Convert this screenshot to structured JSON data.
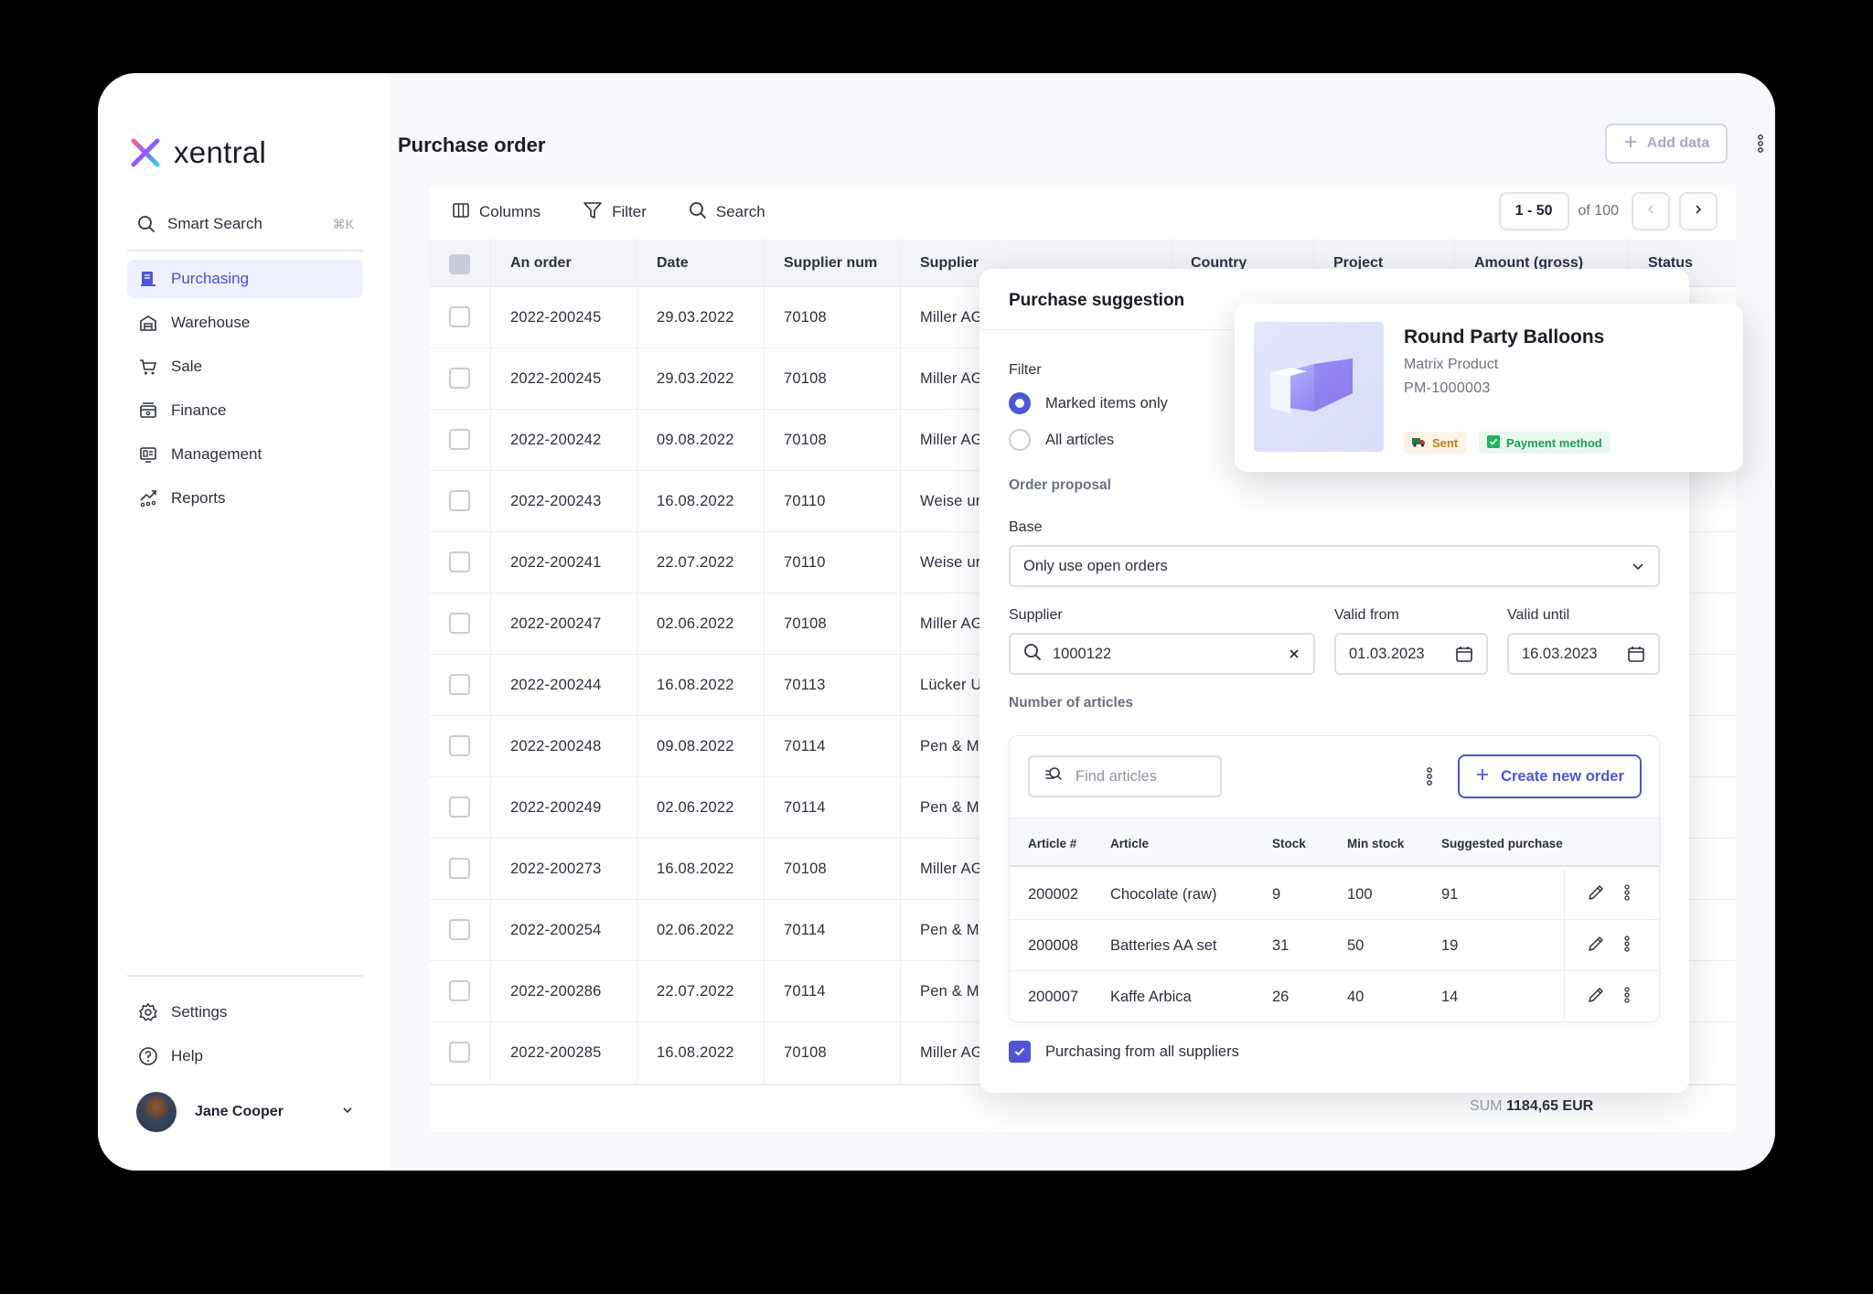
{
  "app": {
    "brand": "xentral",
    "accent": "#5054d6"
  },
  "sidebar": {
    "search_label": "Smart Search",
    "search_shortcut": "⌘K",
    "items": [
      {
        "label": "Purchasing",
        "icon": "purchasing-icon",
        "active": true
      },
      {
        "label": "Warehouse",
        "icon": "warehouse-icon"
      },
      {
        "label": "Sale",
        "icon": "cart-icon"
      },
      {
        "label": "Finance",
        "icon": "finance-icon"
      },
      {
        "label": "Management",
        "icon": "management-icon"
      },
      {
        "label": "Reports",
        "icon": "reports-icon"
      }
    ],
    "bottom_items": [
      {
        "label": "Settings",
        "icon": "gear-icon"
      },
      {
        "label": "Help",
        "icon": "help-icon"
      }
    ],
    "user_name": "Jane Cooper"
  },
  "header": {
    "title": "Purchase order",
    "add_label": "Add data"
  },
  "toolbar": {
    "columns_label": "Columns",
    "filter_label": "Filter",
    "search_label": "Search",
    "page_range": "1 - 50",
    "page_total": "of 100"
  },
  "table": {
    "columns": [
      "An order",
      "Date",
      "Supplier num",
      "Supplier",
      "Country",
      "Project",
      "Amount (gross)",
      "Status"
    ],
    "rows": [
      [
        "2022-200245",
        "29.03.2022",
        "70108",
        "Miller AG"
      ],
      [
        "2022-200245",
        "29.03.2022",
        "70108",
        "Miller AG"
      ],
      [
        "2022-200242",
        "09.08.2022",
        "70108",
        "Miller AG"
      ],
      [
        "2022-200243",
        "16.08.2022",
        "70110",
        "Weise ur"
      ],
      [
        "2022-200241",
        "22.07.2022",
        "70110",
        "Weise ur"
      ],
      [
        "2022-200247",
        "02.06.2022",
        "70108",
        "Miller AG"
      ],
      [
        "2022-200244",
        "16.08.2022",
        "70113",
        "Lücker U"
      ],
      [
        "2022-200248",
        "09.08.2022",
        "70114",
        "Pen & Mo"
      ],
      [
        "2022-200249",
        "02.06.2022",
        "70114",
        "Pen & Mo"
      ],
      [
        "2022-200273",
        "16.08.2022",
        "70108",
        "Miller AG"
      ],
      [
        "2022-200254",
        "02.06.2022",
        "70114",
        "Pen & Mo"
      ],
      [
        "2022-200286",
        "22.07.2022",
        "70114",
        "Pen & Mo"
      ],
      [
        "2022-200285",
        "16.08.2022",
        "70108",
        "Miller AG"
      ]
    ],
    "sum_label": "SUM",
    "sum_value": "1184,65 EUR"
  },
  "panel": {
    "title": "Purchase suggestion",
    "filter_label": "Filter",
    "radio_marked": "Marked items only",
    "radio_all": "All articles",
    "order_proposal_label": "Order proposal",
    "base_label": "Base",
    "base_value": "Only use open orders",
    "supplier_label": "Supplier",
    "supplier_value": "1000122",
    "valid_from_label": "Valid from",
    "valid_from_value": "01.03.2023",
    "valid_until_label": "Valid until",
    "valid_until_value": "16.03.2023",
    "number_label": "Number of articles",
    "find_placeholder": "Find articles",
    "create_label": "Create new order",
    "article_columns": [
      "Article #",
      "Article",
      "Stock",
      "Min stock",
      "Suggested purchase"
    ],
    "articles": [
      [
        "200002",
        "Chocolate (raw)",
        "9",
        "100",
        "91"
      ],
      [
        "200008",
        "Batteries AA set",
        "31",
        "50",
        "19"
      ],
      [
        "200007",
        "Kaffe Arbica",
        "26",
        "40",
        "14"
      ]
    ],
    "all_suppliers_label": "Purchasing from all suppliers"
  },
  "product": {
    "name": "Round Party Balloons",
    "type": "Matrix Product",
    "code": "PM-1000003",
    "badge_sent": "Sent",
    "badge_payment": "Payment method"
  }
}
